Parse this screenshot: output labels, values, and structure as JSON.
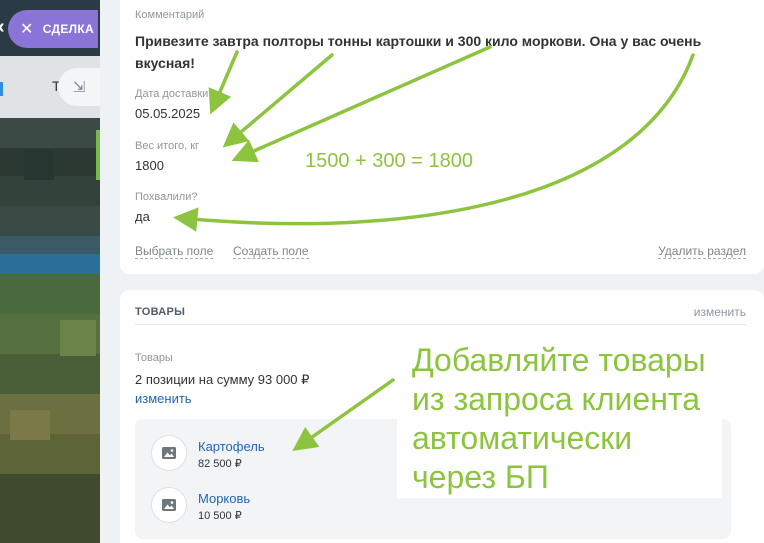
{
  "left_panel": {
    "deal_label": "СДЕЛКА",
    "back_glyph": "‹",
    "close_glyph": "✕",
    "tab_letter": "Т",
    "collapse_glyph": "⇲"
  },
  "details_card": {
    "comment_label": "Комментарий",
    "comment_text": "Привезите завтра полторы тонны картошки и 300 кило моркови. Она у вас очень вкусная!",
    "delivery_date_label": "Дата доставки",
    "delivery_date_value": "05.05.2025",
    "weight_label": "Вес итого, кг",
    "weight_value": "1800",
    "praised_label": "Похвалили?",
    "praised_value": "да",
    "select_field_link": "Выбрать поле",
    "create_field_link": "Создать поле",
    "delete_section_link": "Удалить раздел"
  },
  "products_card": {
    "section_title": "ТОВАРЫ",
    "edit_label": "изменить",
    "products_label": "Товары",
    "summary": "2 позиции на сумму 93 000 ₽",
    "summary_edit_link": "изменить",
    "items": [
      {
        "name": "Картофель",
        "price": "82 500 ₽",
        "icon": "image-placeholder-icon"
      },
      {
        "name": "Морковь",
        "price": "10 500 ₽",
        "icon": "image-placeholder-icon"
      }
    ]
  },
  "annotations": {
    "sum_note": "1500 + 300 = 1800",
    "big_note": "Добавляйте товары из запроса клиента автоматически через БП",
    "color": "#8dc43f"
  },
  "colors": {
    "deal_pill": "#8b74d8",
    "link_blue": "#2067b0",
    "annotation_green": "#8dc43f"
  }
}
